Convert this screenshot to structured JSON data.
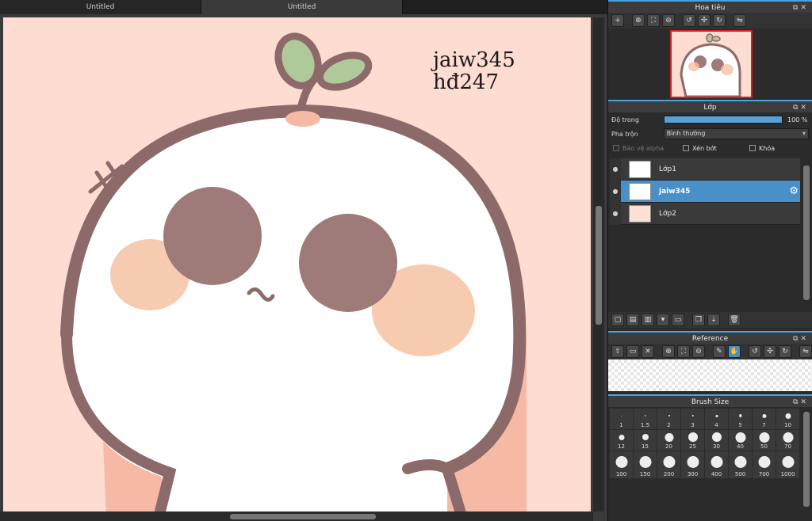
{
  "tabs": [
    {
      "label": "Untitled"
    },
    {
      "label": "Untitled"
    }
  ],
  "canvas": {
    "text_line1": "jaiw345",
    "text_line2": "hđ247"
  },
  "navigator": {
    "title": "Hoa tiêu"
  },
  "layer_panel": {
    "title": "Lớp",
    "opacity_label": "Độ trong",
    "opacity_value": "100 %",
    "opacity": 1.0,
    "blend_label": "Pha trộn",
    "blend_value": "Bình thường",
    "protect_alpha": "Bảo vệ alpha",
    "clipping": "Xén bớt",
    "lock": "Khóa",
    "layers": [
      {
        "name": "Lớp1",
        "selected": false
      },
      {
        "name": "jaiw345",
        "selected": true
      },
      {
        "name": "Lớp2",
        "selected": false
      }
    ]
  },
  "reference": {
    "title": "Reference"
  },
  "brush_size": {
    "title": "Brush Size",
    "sizes": [
      "1",
      "1.5",
      "2",
      "3",
      "4",
      "5",
      "7",
      "10",
      "12",
      "15",
      "20",
      "25",
      "30",
      "40",
      "50",
      "70",
      "100",
      "150",
      "200",
      "300",
      "400",
      "500",
      "700",
      "1000"
    ]
  },
  "colors": {
    "canvas_bg": "#fddcd1",
    "outline": "#8c6a6a",
    "eyes": "#9e7a78",
    "leaf": "#b0c99a",
    "blush": "#f6c2a2",
    "accent": "#4a90c8"
  }
}
